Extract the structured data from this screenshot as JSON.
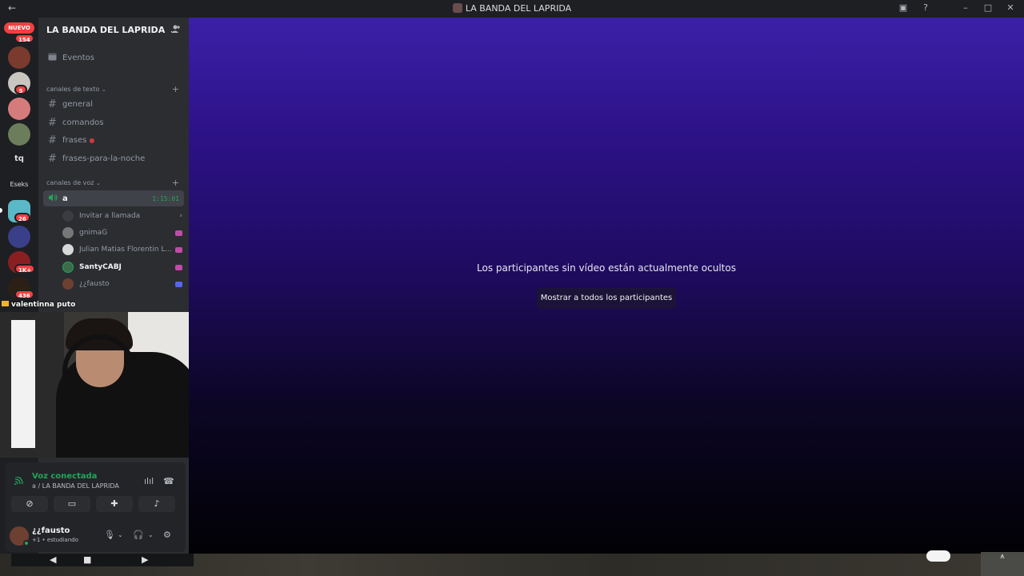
{
  "titlebar": {
    "back": "←",
    "title": "LA BANDA DEL LAPRIDA",
    "icons": [
      "inbox-icon",
      "help-icon",
      "minimize-icon",
      "maximize-icon",
      "close-icon"
    ],
    "glyphs": [
      "▣",
      "?",
      "–",
      "□",
      "✕"
    ]
  },
  "rail": {
    "nuevo": "NUEVO",
    "badge_nuevo": "154",
    "badges": [
      "5",
      "26",
      "1K+",
      "436"
    ],
    "text_servers": [
      "tq",
      "Eseks"
    ]
  },
  "sidebar": {
    "server_name": "LA BANDA DEL LAPRIDA",
    "chevron": "⌄",
    "events": "Eventos",
    "text_category": "canales de texto",
    "text_channels": [
      "general",
      "comandos",
      "frases",
      "frases-para-la-noche"
    ],
    "voice_category": "canales de voz",
    "voice_channel": "a",
    "voice_timer": "1:15:01",
    "invite_call": "Invitar a llamada",
    "members": [
      "gnimaG",
      "Julian Matias Florentin L...",
      "SantyCABJ",
      "¿¿fausto"
    ]
  },
  "camera": {
    "label": "valentinna puto"
  },
  "voice_panel": {
    "title": "Voz conectada",
    "subtitle": "a / LA BANDA DEL LAPRIDA",
    "user_name": "¿¿fausto",
    "user_status": "+1 • estudiando"
  },
  "stage": {
    "message": "Los participantes sin vídeo están actualmente ocultos",
    "button": "Mostrar a todos los participantes"
  },
  "colors": {
    "accent_green": "#23a55a",
    "badge_red": "#f23f42",
    "stage_top": "#3b20a8"
  }
}
